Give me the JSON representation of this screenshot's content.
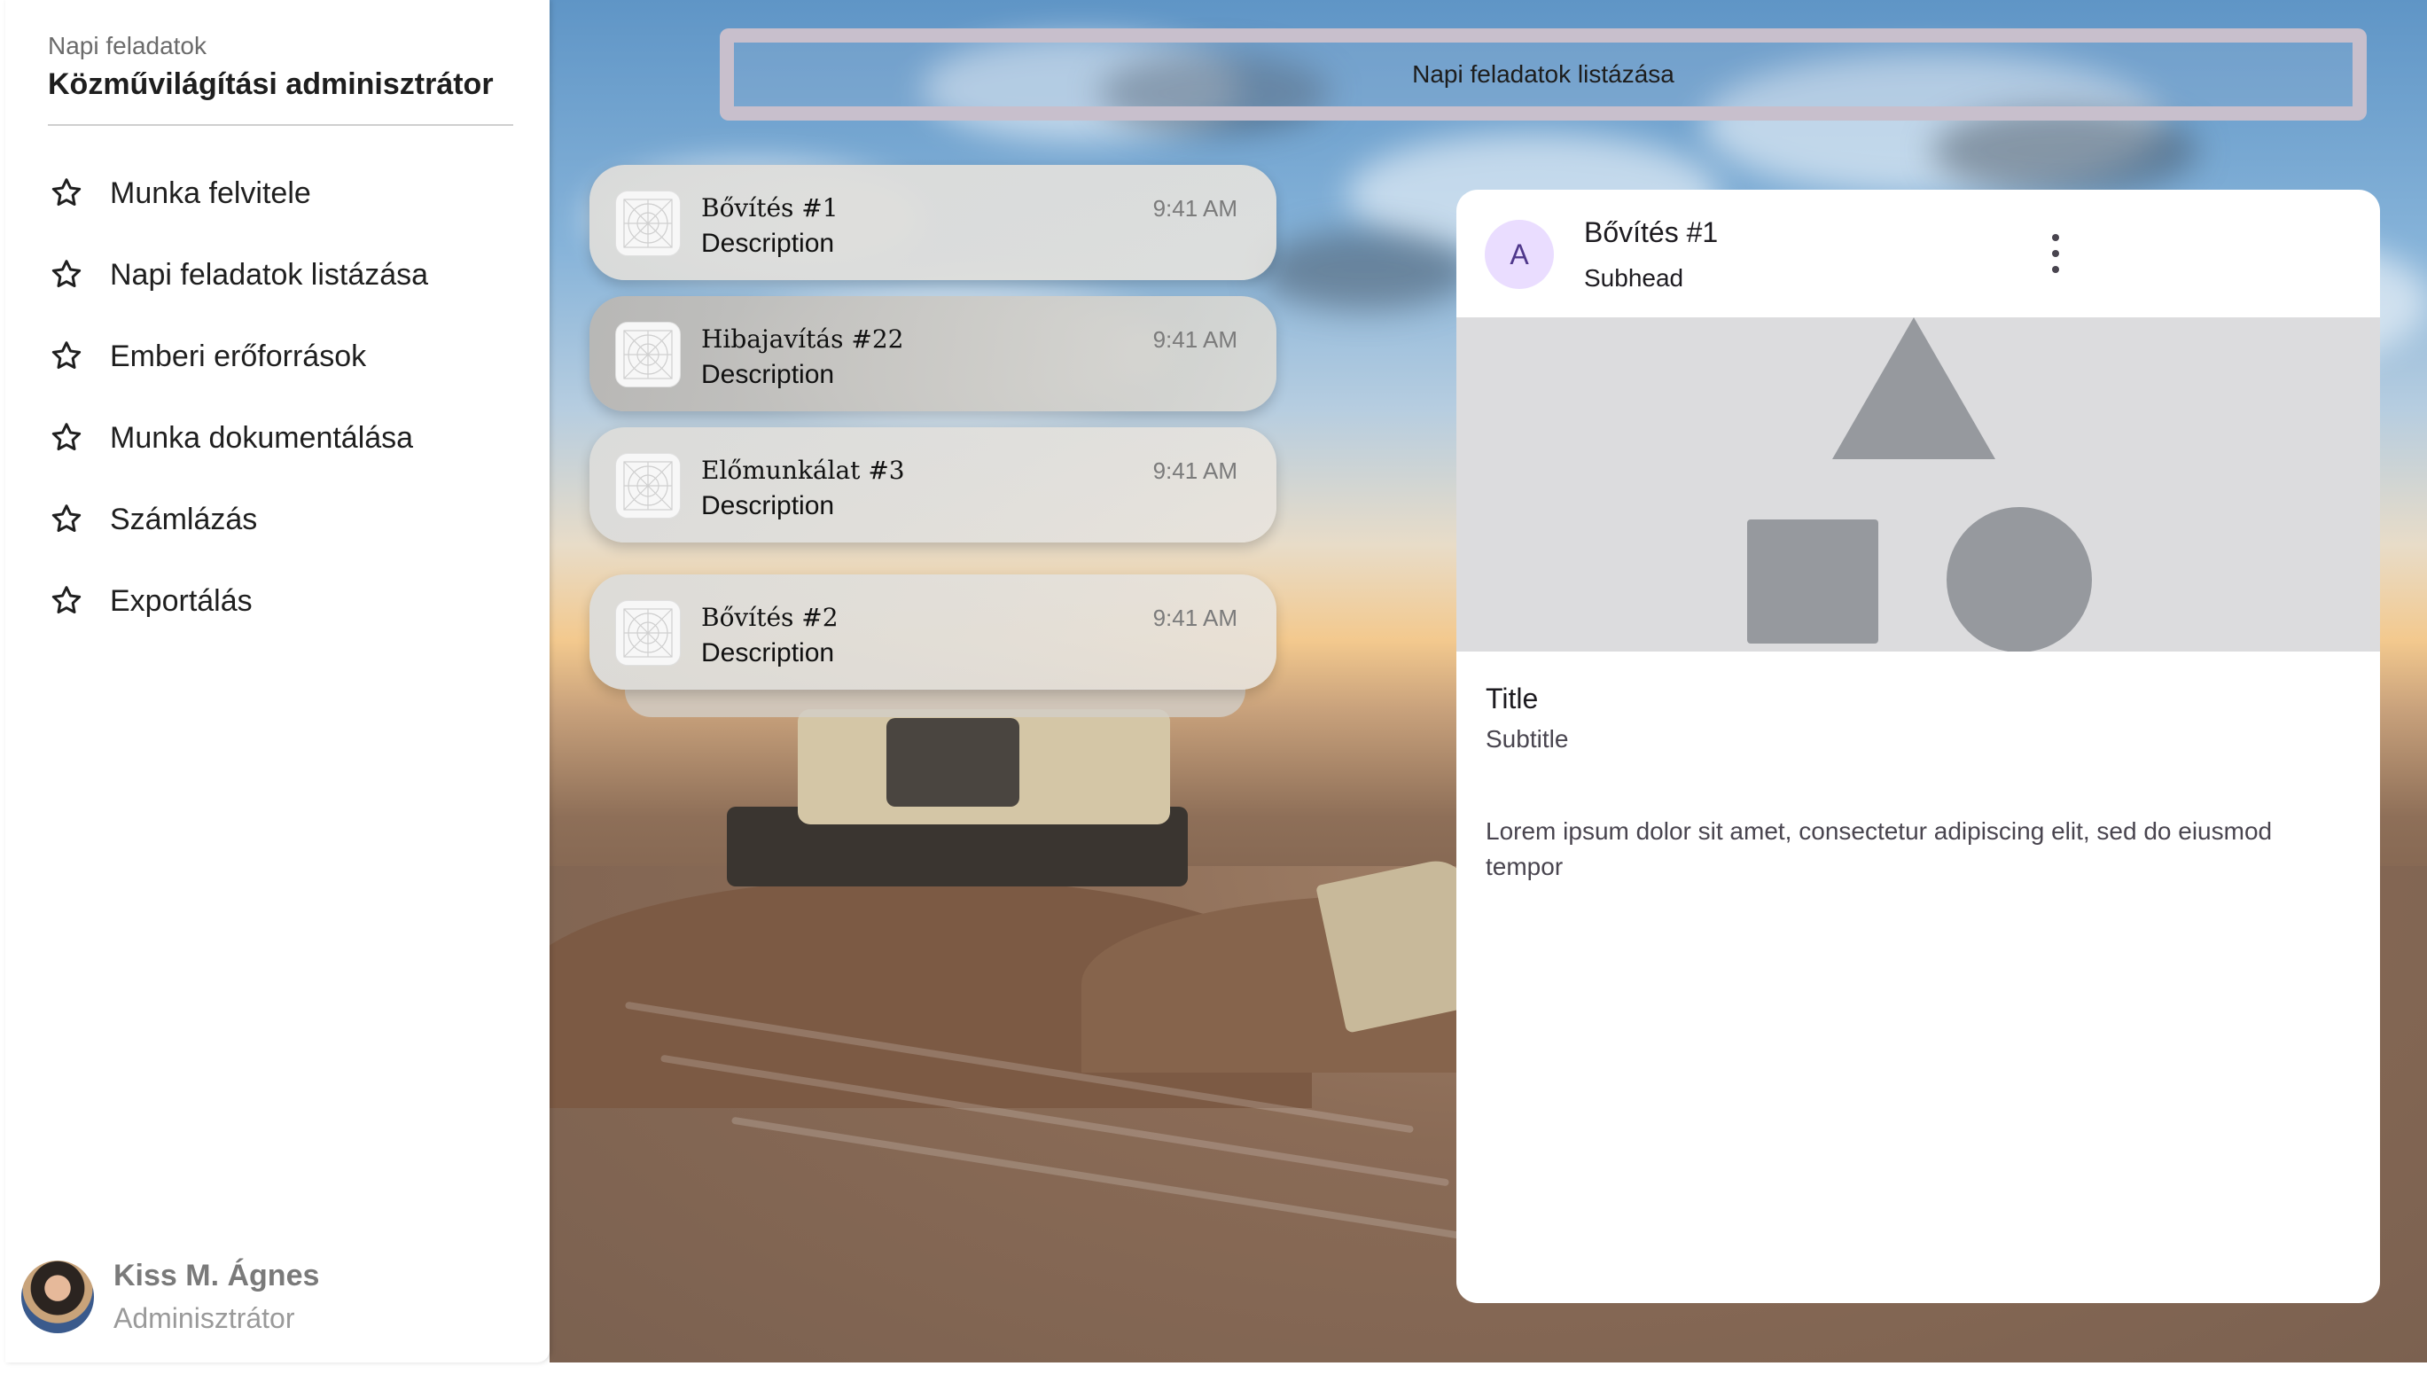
{
  "sidebar": {
    "caption": "Napi feladatok",
    "title": "Közművilágítási adminisztrátor",
    "items": [
      {
        "label": "Munka felvitele",
        "icon": "star-icon"
      },
      {
        "label": "Napi feladatok listázása",
        "icon": "star-icon"
      },
      {
        "label": "Emberi erőforrások",
        "icon": "star-icon"
      },
      {
        "label": "Munka dokumentálása",
        "icon": "star-icon"
      },
      {
        "label": "Számlázás",
        "icon": "star-icon"
      },
      {
        "label": "Exportálás",
        "icon": "star-icon"
      }
    ],
    "user": {
      "name": "Kiss M. Ágnes",
      "role": "Adminisztrátor"
    }
  },
  "topbar": {
    "title": "Napi feladatok listázása"
  },
  "tasks": [
    {
      "title": "Bővítés #1",
      "description": "Description",
      "time": "9:41 AM"
    },
    {
      "title": "Hibajavítás #22",
      "description": "Description",
      "time": "9:41 AM"
    },
    {
      "title": "Előmunkálat #3",
      "description": "Description",
      "time": "9:41 AM"
    },
    {
      "title": "Bővítés #2",
      "description": "Description",
      "time": "9:41 AM"
    }
  ],
  "detail": {
    "avatar_letter": "A",
    "header": "Bővítés #1",
    "subhead": "Subhead",
    "title": "Title",
    "subtitle": "Subtitle",
    "body": "Lorem ipsum dolor sit amet, consectetur adipiscing elit, sed do eiusmod tempor"
  },
  "colors": {
    "accent_avatar_bg": "#eaddff",
    "accent_avatar_fg": "#4f378b",
    "topbar_border": "#c8bfcc"
  }
}
